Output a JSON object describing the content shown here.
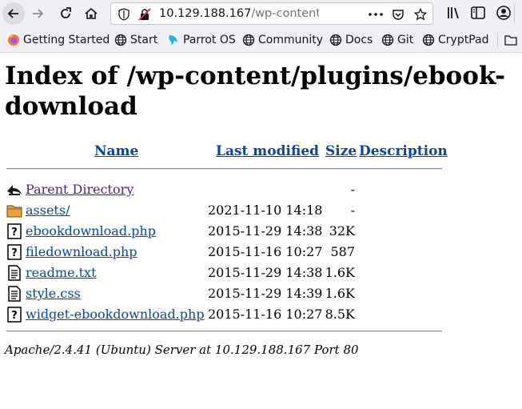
{
  "browser": {
    "url_host": "10.129.188.167",
    "url_path": "/wp-content/plugins/",
    "bookmarks": [
      {
        "label": "Getting Started",
        "icon": "firefox-icon"
      },
      {
        "label": "Start",
        "icon": "globe-icon"
      },
      {
        "label": "Parrot OS",
        "icon": "parrot-icon"
      },
      {
        "label": "Community",
        "icon": "globe-icon"
      },
      {
        "label": "Docs",
        "icon": "globe-icon"
      },
      {
        "label": "Git",
        "icon": "globe-icon"
      },
      {
        "label": "CryptPad",
        "icon": "globe-icon"
      }
    ]
  },
  "page": {
    "title": "Index of /wp-content/plugins/ebook-download",
    "columns": {
      "name": "Name",
      "last_modified": "Last modified",
      "size": "Size",
      "description": "Description"
    },
    "entries": [
      {
        "name": "Parent Directory",
        "date": "",
        "size": "-",
        "icon": "back-icon"
      },
      {
        "name": "assets/",
        "date": "2021-11-10 14:18",
        "size": "-",
        "icon": "folder-icon"
      },
      {
        "name": "ebookdownload.php",
        "date": "2015-11-29 14:38",
        "size": "32K",
        "icon": "unknown-file-icon"
      },
      {
        "name": "filedownload.php",
        "date": "2015-11-16 10:27",
        "size": "587",
        "icon": "unknown-file-icon"
      },
      {
        "name": "readme.txt",
        "date": "2015-11-29 14:38",
        "size": "1.6K",
        "icon": "text-file-icon"
      },
      {
        "name": "style.css",
        "date": "2015-11-29 14:39",
        "size": "1.6K",
        "icon": "text-file-icon"
      },
      {
        "name": "widget-ebookdownload.php",
        "date": "2015-11-16 10:27",
        "size": "8.5K",
        "icon": "unknown-file-icon"
      }
    ],
    "footer": "Apache/2.4.41 (Ubuntu) Server at 10.129.188.167 Port 80"
  },
  "colors": {
    "link": "#0645ad",
    "visited": "#551a8b",
    "toolbar": "#f0f0f4"
  }
}
